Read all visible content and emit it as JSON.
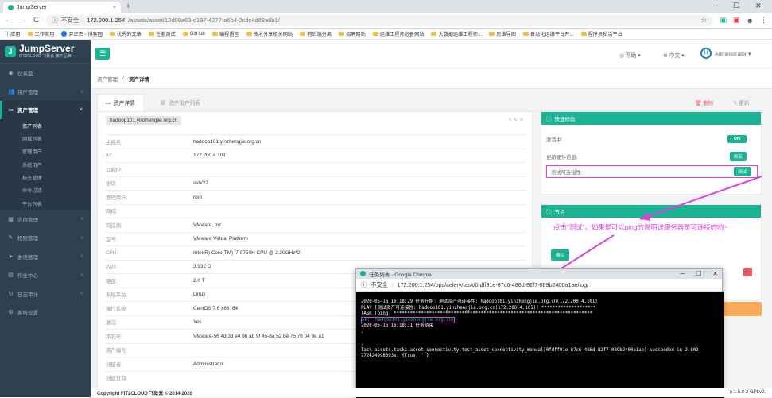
{
  "browser": {
    "tab_title": "JumpServer",
    "tab_close": "×",
    "new_tab": "+",
    "url_insecure": "不安全",
    "url_host": "172.200.1.254",
    "url_path": "/assets/asset/12d09a63-d197-4277-a6b4-2cdc4d89a6b1/",
    "bookmarks": [
      "应用",
      "工作常用",
      "尹正杰 - 博客园",
      "优秀的文章",
      "性能测试",
      "GitHub",
      "编程语言",
      "技术分享相关网站",
      "前后端分离",
      "招聘网站",
      "运维工程师必备网站",
      "大数据运维工程师...",
      "思维导图",
      "自动化运维平台开...",
      "程序员私活平台"
    ]
  },
  "sidebar": {
    "logo_title": "JumpServer",
    "logo_sub": "FIT2CLOUD 飞致云 旗下品牌",
    "menu": [
      {
        "label": "仪表盘",
        "icon": "◉"
      },
      {
        "label": "用户管理",
        "icon": "👥"
      },
      {
        "label": "资产管理",
        "icon": "▭"
      }
    ],
    "sub": [
      "资产列表",
      "网域列表",
      "管理用户",
      "系统用户",
      "标签管理",
      "命令过滤",
      "平台列表"
    ],
    "menu2": [
      {
        "label": "应用管理",
        "icon": "▦"
      },
      {
        "label": "权限管理",
        "icon": "✎"
      },
      {
        "label": "会话管理",
        "icon": "➤"
      },
      {
        "label": "作业中心",
        "icon": "▤"
      },
      {
        "label": "日志审计",
        "icon": "↻"
      },
      {
        "label": "系统设置",
        "icon": "⚙"
      }
    ]
  },
  "topbar": {
    "help": "帮助",
    "lang": "中文",
    "user": "Administrator"
  },
  "breadcrumb": {
    "parent": "资产管理",
    "current": "资产详情"
  },
  "tabs": {
    "detail": "资产详情",
    "users": "资产用户列表",
    "delete": "删除",
    "update": "更新"
  },
  "detail": {
    "title": "hadoop101.yinzhengjie.org.cn",
    "rows": [
      {
        "k": "主机名:",
        "v": "hadoop101.yinzhengjie.org.cn"
      },
      {
        "k": "IP:",
        "v": "172.200.4.101"
      },
      {
        "k": "公网IP:",
        "v": ""
      },
      {
        "k": "协议",
        "v": "ssh/22"
      },
      {
        "k": "管理用户:",
        "v": "root"
      },
      {
        "k": "网域:",
        "v": ""
      },
      {
        "k": "制造商:",
        "v": "VMware, Inc."
      },
      {
        "k": "型号:",
        "v": "VMware Virtual Platform"
      },
      {
        "k": "CPU:",
        "v": "Intel(R) Core(TM) i7-8750H CPU @ 2.20GHz*2"
      },
      {
        "k": "内存:",
        "v": "3.932 G"
      },
      {
        "k": "硬盘:",
        "v": "2.0 T"
      },
      {
        "k": "系统平台:",
        "v": "Linux"
      },
      {
        "k": "操作系统:",
        "v": "CentOS 7.6 x86_64"
      },
      {
        "k": "激活:",
        "v": "Yes"
      },
      {
        "k": "序列号:",
        "v": "VMware-56 4d 3d e4 9b ab 9f 45-8a 52 be 75 76 04 9e a1"
      },
      {
        "k": "资产编号:",
        "v": ""
      },
      {
        "k": "创建者:",
        "v": "Administrator"
      },
      {
        "k": "创建日期:",
        "v": ""
      }
    ]
  },
  "quick": {
    "title": "快速修改",
    "active_label": "激活中:",
    "active_value": "ON",
    "hw_label": "更新硬件信息:",
    "hw_btn": "刷新",
    "conn_label": "测试可连接性:",
    "conn_btn": "测试"
  },
  "nodes": {
    "title": "节点",
    "sub": "节点",
    "confirm": "确认"
  },
  "annotation": "点击\"测试\"，如果是可以ping的说明该服务器是可连接的哟~",
  "popup": {
    "title": "任务列表 - Google Chrome",
    "insecure": "不安全",
    "url": "172.200.1.254/ops/celery/task/0fdff91e-87c6-486d-82f7-089b2400a1ae/log/",
    "lines": [
      "2020-05-16 16:18:29 任务开始: 测试资产可连接性: hadoop101.yinzhengjie.org.cn(172.200.4.101)",
      "PLAY [测试资产可连接性: hadoop101.yinzhengjie.org.cn(172.200.4.101)] ********************",
      "TASK [ping] *************************************************************************"
    ],
    "ok": "ok: [hadoop101.yinzhengjie.org.cn]",
    "end": "2020-05-16 16:18:31 任务结束",
    "dot1": ".",
    "dot2": ".",
    "task1": "Task assets.tasks.asset_connectivity.test_asset_connectivity_manual[0fdff91e-87c6-486d-82f7-089b2400a1ae] succeeded in 2.802",
    "task2": "772424998693s: {True, ''}"
  },
  "footer": {
    "copyright": "Copyright FIT2CLOUD 飞致云 © 2014-2020",
    "version": "n 1.5.8-2 GPLv2."
  }
}
